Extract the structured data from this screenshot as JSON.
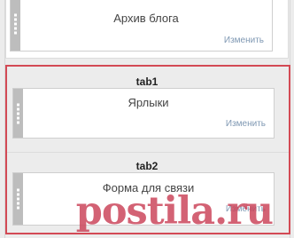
{
  "layout_widgets": [
    {
      "title": "Архив блога",
      "edit_label": "Изменить"
    }
  ],
  "tabs": [
    {
      "label": "tab1",
      "widget": {
        "title": "Ярлыки",
        "edit_label": "Изменить"
      }
    },
    {
      "label": "tab2",
      "widget": {
        "title": "Форма для связи",
        "edit_label": "Изменить"
      }
    }
  ],
  "watermark": {
    "text": "postila.ru"
  },
  "colors": {
    "highlight_frame": "#d34a55",
    "edit_link": "#7f98b3",
    "watermark": "#c94056",
    "handle": "#bdbdbd"
  }
}
